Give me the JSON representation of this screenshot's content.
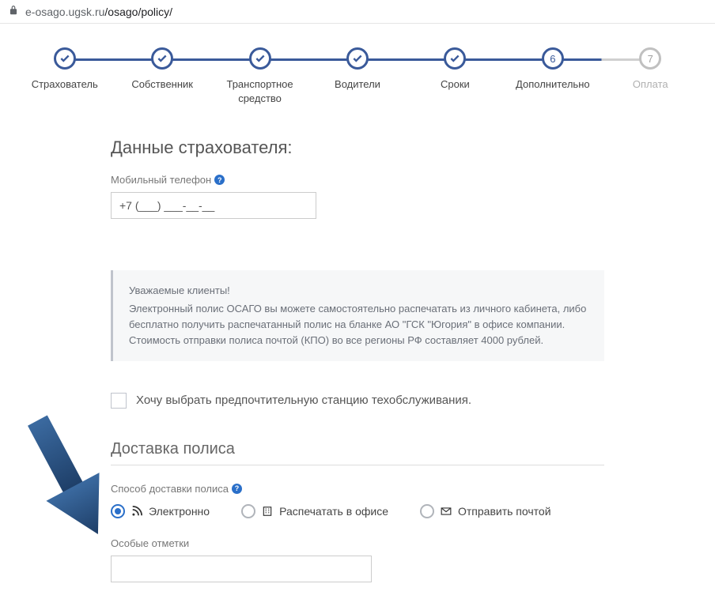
{
  "url": {
    "host": "e-osago.ugsk.ru",
    "path": "/osago/policy/"
  },
  "stepper": {
    "steps": [
      {
        "label": "Страхователь",
        "state": "done"
      },
      {
        "label": "Собственник",
        "state": "done"
      },
      {
        "label": "Транспортное средство",
        "state": "done"
      },
      {
        "label": "Водители",
        "state": "done"
      },
      {
        "label": "Сроки",
        "state": "done"
      },
      {
        "label": "Дополнительно",
        "state": "current",
        "num": "6"
      },
      {
        "label": "Оплата",
        "state": "future",
        "num": "7"
      }
    ]
  },
  "insurer": {
    "title": "Данные страхователя:",
    "phone_label": "Мобильный телефон",
    "phone_value": "+7 (___) ___-__-__"
  },
  "info": {
    "greet": "Уважаемые клиенты!",
    "line1": "Электронный полис ОСАГО вы можете самостоятельно распечатать из личного кабинета, либо бесплатно получить распечатанный полис на бланке АО \"ГСК \"Югория\" в офисе компании.",
    "line2": "Стоимость отправки полиса почтой (КПО) во все регионы РФ составляет 4000 рублей."
  },
  "checkbox_station": "Хочу выбрать предпочтительную станцию техобслуживания.",
  "delivery": {
    "title": "Доставка полиса",
    "method_label": "Способ доставки полиса",
    "options": {
      "electronic": "Электронно",
      "office": "Распечатать в офисе",
      "mail": "Отправить почтой"
    },
    "selected": "electronic",
    "notes_label": "Особые отметки"
  }
}
